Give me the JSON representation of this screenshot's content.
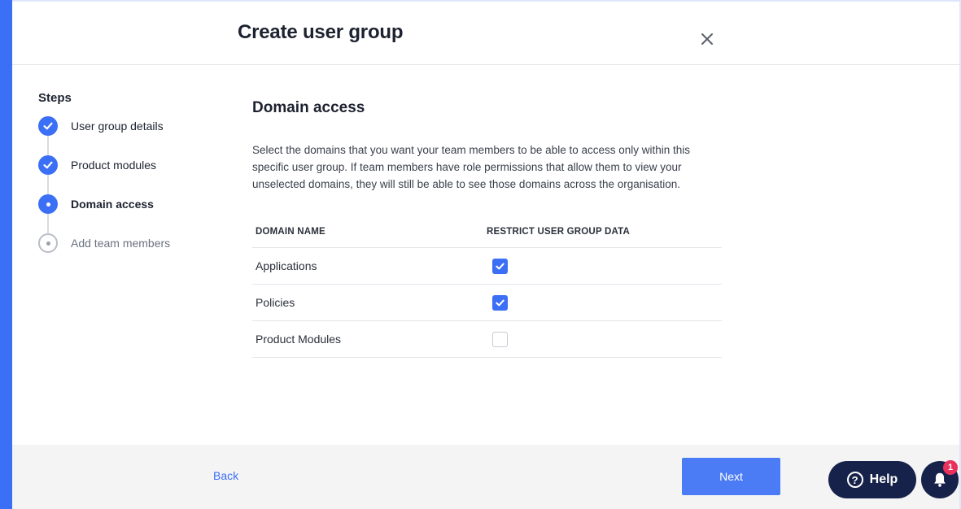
{
  "dialog": {
    "title": "Create user group"
  },
  "steps": {
    "heading": "Steps",
    "items": [
      {
        "label": "User group details",
        "state": "done"
      },
      {
        "label": "Product modules",
        "state": "done"
      },
      {
        "label": "Domain access",
        "state": "current"
      },
      {
        "label": "Add team members",
        "state": "pending"
      }
    ]
  },
  "main": {
    "section_title": "Domain access",
    "description": "Select the domains that you want your team members to be able to access only within this specific user group. If team members have role permissions that allow them to view your unselected domains, they will still be able to see those domains across the organisation.",
    "table": {
      "col_domain": "DOMAIN NAME",
      "col_restrict": "RESTRICT USER GROUP DATA",
      "rows": [
        {
          "name": "Applications",
          "checked": true
        },
        {
          "name": "Policies",
          "checked": true
        },
        {
          "name": "Product Modules",
          "checked": false
        }
      ]
    }
  },
  "footer": {
    "back_label": "Back",
    "next_label": "Next"
  },
  "widgets": {
    "help_label": "Help",
    "help_glyph": "?",
    "notification_count": "1"
  },
  "colors": {
    "accent": "#3b6ff5",
    "help_bg": "#16224a",
    "badge": "#e8315b"
  }
}
